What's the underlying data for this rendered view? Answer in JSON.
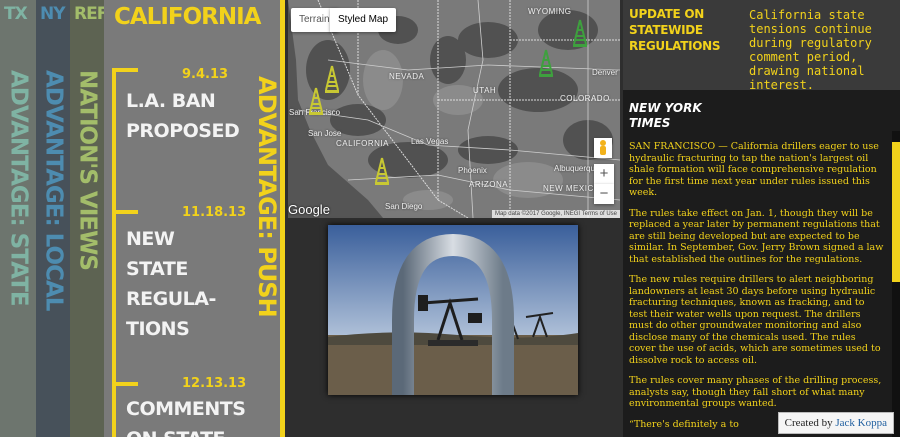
{
  "tabs": [
    {
      "abbr": "TX",
      "full": "ADVANTAGE: STATE"
    },
    {
      "abbr": "NY",
      "full": "ADVANTAGE: LOCAL"
    },
    {
      "abbr": "REF",
      "full": "NATION'S VIEWS"
    }
  ],
  "california": {
    "title": "CALIFORNIA",
    "vertical_label": "ADVANTAGE: PUSH",
    "timeline": [
      {
        "date": "9.4.13",
        "headline": "L.A. BAN PROPOSED"
      },
      {
        "date": "11.18.13",
        "headline": "NEW STATE REGULA- TIONS"
      },
      {
        "date": "12.13.13",
        "headline": "COMMENTS ON STATE"
      }
    ]
  },
  "map": {
    "buttons": {
      "terrain": "Terrain",
      "styled": "Styled Map"
    },
    "regions": {
      "nevada": "NEVADA",
      "utah": "UTAH",
      "wyoming": "WYOMING",
      "colorado": "COLORADO",
      "california": "CALIFORNIA",
      "arizona": "ARIZONA",
      "new_mexico": "NEW MEXICO"
    },
    "cities": {
      "san_francisco": "San Francisco",
      "san_jose": "San Jose",
      "las_vegas": "Las Vegas",
      "phoenix": "Phoenix",
      "san_diego": "San Diego",
      "albuquerque": "Albuquerque",
      "denver": "Denver"
    },
    "google": "Google",
    "attribution": "Map data ©2017 Google, INEGI   Terms of Use",
    "zoom_in": "+",
    "zoom_out": "−"
  },
  "right_panel": {
    "update_title": "UPDATE ON STATEWIDE REGULATIONS",
    "update_text": "California state tensions continue during regulatory comment period, drawing national interest.",
    "source": "NEW YORK TIMES",
    "paragraphs": [
      "SAN FRANCISCO — California drillers eager to use hydraulic fracturing to tap the nation's largest oil shale formation will face comprehensive regulation for the first time next year under rules issued this week.",
      "The rules take effect on Jan. 1, though they will be replaced a year later by permanent regulations that are still being developed but are expected to be similar. In September, Gov. Jerry Brown signed a law that established the outlines for the regulations.",
      "The new rules require drillers to alert neighboring landowners at least 30 days before using hydraulic fracturing techniques, known as fracking, and to test their water wells upon request. The drillers must do other groundwater monitoring and also disclose many of the chemicals used. The rules cover the use of acids, which are sometimes used to dissolve rock to access oil.",
      "The rules cover many phases of the drilling process, analysts say, though they fall short of what many environmental groups wanted.",
      "“There's definitely a to"
    ]
  },
  "credit": {
    "prefix": "Created by",
    "author": "Jack Koppa"
  },
  "colors": {
    "accent": "#f2d21b",
    "tx": "#7fb3a3",
    "ny": "#4d8cb0",
    "ref": "#a3bd6a"
  }
}
